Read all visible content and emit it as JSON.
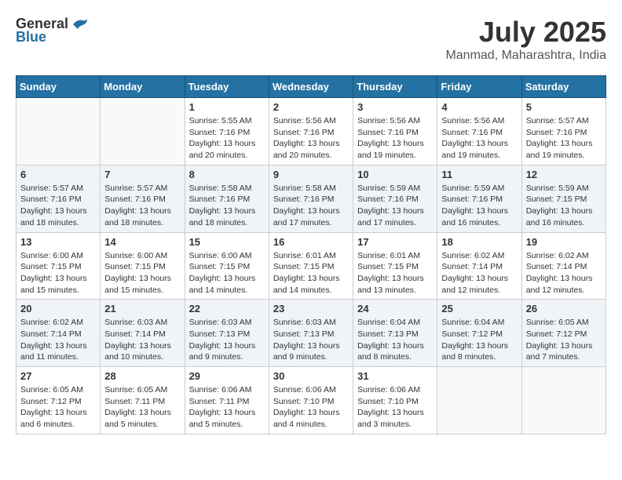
{
  "header": {
    "logo_general": "General",
    "logo_blue": "Blue",
    "month_year": "July 2025",
    "location": "Manmad, Maharashtra, India"
  },
  "days_of_week": [
    "Sunday",
    "Monday",
    "Tuesday",
    "Wednesday",
    "Thursday",
    "Friday",
    "Saturday"
  ],
  "weeks": [
    [
      {
        "day": "",
        "sunrise": "",
        "sunset": "",
        "daylight": ""
      },
      {
        "day": "",
        "sunrise": "",
        "sunset": "",
        "daylight": ""
      },
      {
        "day": "1",
        "sunrise": "Sunrise: 5:55 AM",
        "sunset": "Sunset: 7:16 PM",
        "daylight": "Daylight: 13 hours and 20 minutes."
      },
      {
        "day": "2",
        "sunrise": "Sunrise: 5:56 AM",
        "sunset": "Sunset: 7:16 PM",
        "daylight": "Daylight: 13 hours and 20 minutes."
      },
      {
        "day": "3",
        "sunrise": "Sunrise: 5:56 AM",
        "sunset": "Sunset: 7:16 PM",
        "daylight": "Daylight: 13 hours and 19 minutes."
      },
      {
        "day": "4",
        "sunrise": "Sunrise: 5:56 AM",
        "sunset": "Sunset: 7:16 PM",
        "daylight": "Daylight: 13 hours and 19 minutes."
      },
      {
        "day": "5",
        "sunrise": "Sunrise: 5:57 AM",
        "sunset": "Sunset: 7:16 PM",
        "daylight": "Daylight: 13 hours and 19 minutes."
      }
    ],
    [
      {
        "day": "6",
        "sunrise": "Sunrise: 5:57 AM",
        "sunset": "Sunset: 7:16 PM",
        "daylight": "Daylight: 13 hours and 18 minutes."
      },
      {
        "day": "7",
        "sunrise": "Sunrise: 5:57 AM",
        "sunset": "Sunset: 7:16 PM",
        "daylight": "Daylight: 13 hours and 18 minutes."
      },
      {
        "day": "8",
        "sunrise": "Sunrise: 5:58 AM",
        "sunset": "Sunset: 7:16 PM",
        "daylight": "Daylight: 13 hours and 18 minutes."
      },
      {
        "day": "9",
        "sunrise": "Sunrise: 5:58 AM",
        "sunset": "Sunset: 7:16 PM",
        "daylight": "Daylight: 13 hours and 17 minutes."
      },
      {
        "day": "10",
        "sunrise": "Sunrise: 5:59 AM",
        "sunset": "Sunset: 7:16 PM",
        "daylight": "Daylight: 13 hours and 17 minutes."
      },
      {
        "day": "11",
        "sunrise": "Sunrise: 5:59 AM",
        "sunset": "Sunset: 7:16 PM",
        "daylight": "Daylight: 13 hours and 16 minutes."
      },
      {
        "day": "12",
        "sunrise": "Sunrise: 5:59 AM",
        "sunset": "Sunset: 7:15 PM",
        "daylight": "Daylight: 13 hours and 16 minutes."
      }
    ],
    [
      {
        "day": "13",
        "sunrise": "Sunrise: 6:00 AM",
        "sunset": "Sunset: 7:15 PM",
        "daylight": "Daylight: 13 hours and 15 minutes."
      },
      {
        "day": "14",
        "sunrise": "Sunrise: 6:00 AM",
        "sunset": "Sunset: 7:15 PM",
        "daylight": "Daylight: 13 hours and 15 minutes."
      },
      {
        "day": "15",
        "sunrise": "Sunrise: 6:00 AM",
        "sunset": "Sunset: 7:15 PM",
        "daylight": "Daylight: 13 hours and 14 minutes."
      },
      {
        "day": "16",
        "sunrise": "Sunrise: 6:01 AM",
        "sunset": "Sunset: 7:15 PM",
        "daylight": "Daylight: 13 hours and 14 minutes."
      },
      {
        "day": "17",
        "sunrise": "Sunrise: 6:01 AM",
        "sunset": "Sunset: 7:15 PM",
        "daylight": "Daylight: 13 hours and 13 minutes."
      },
      {
        "day": "18",
        "sunrise": "Sunrise: 6:02 AM",
        "sunset": "Sunset: 7:14 PM",
        "daylight": "Daylight: 13 hours and 12 minutes."
      },
      {
        "day": "19",
        "sunrise": "Sunrise: 6:02 AM",
        "sunset": "Sunset: 7:14 PM",
        "daylight": "Daylight: 13 hours and 12 minutes."
      }
    ],
    [
      {
        "day": "20",
        "sunrise": "Sunrise: 6:02 AM",
        "sunset": "Sunset: 7:14 PM",
        "daylight": "Daylight: 13 hours and 11 minutes."
      },
      {
        "day": "21",
        "sunrise": "Sunrise: 6:03 AM",
        "sunset": "Sunset: 7:14 PM",
        "daylight": "Daylight: 13 hours and 10 minutes."
      },
      {
        "day": "22",
        "sunrise": "Sunrise: 6:03 AM",
        "sunset": "Sunset: 7:13 PM",
        "daylight": "Daylight: 13 hours and 9 minutes."
      },
      {
        "day": "23",
        "sunrise": "Sunrise: 6:03 AM",
        "sunset": "Sunset: 7:13 PM",
        "daylight": "Daylight: 13 hours and 9 minutes."
      },
      {
        "day": "24",
        "sunrise": "Sunrise: 6:04 AM",
        "sunset": "Sunset: 7:13 PM",
        "daylight": "Daylight: 13 hours and 8 minutes."
      },
      {
        "day": "25",
        "sunrise": "Sunrise: 6:04 AM",
        "sunset": "Sunset: 7:12 PM",
        "daylight": "Daylight: 13 hours and 8 minutes."
      },
      {
        "day": "26",
        "sunrise": "Sunrise: 6:05 AM",
        "sunset": "Sunset: 7:12 PM",
        "daylight": "Daylight: 13 hours and 7 minutes."
      }
    ],
    [
      {
        "day": "27",
        "sunrise": "Sunrise: 6:05 AM",
        "sunset": "Sunset: 7:12 PM",
        "daylight": "Daylight: 13 hours and 6 minutes."
      },
      {
        "day": "28",
        "sunrise": "Sunrise: 6:05 AM",
        "sunset": "Sunset: 7:11 PM",
        "daylight": "Daylight: 13 hours and 5 minutes."
      },
      {
        "day": "29",
        "sunrise": "Sunrise: 6:06 AM",
        "sunset": "Sunset: 7:11 PM",
        "daylight": "Daylight: 13 hours and 5 minutes."
      },
      {
        "day": "30",
        "sunrise": "Sunrise: 6:06 AM",
        "sunset": "Sunset: 7:10 PM",
        "daylight": "Daylight: 13 hours and 4 minutes."
      },
      {
        "day": "31",
        "sunrise": "Sunrise: 6:06 AM",
        "sunset": "Sunset: 7:10 PM",
        "daylight": "Daylight: 13 hours and 3 minutes."
      },
      {
        "day": "",
        "sunrise": "",
        "sunset": "",
        "daylight": ""
      },
      {
        "day": "",
        "sunrise": "",
        "sunset": "",
        "daylight": ""
      }
    ]
  ]
}
